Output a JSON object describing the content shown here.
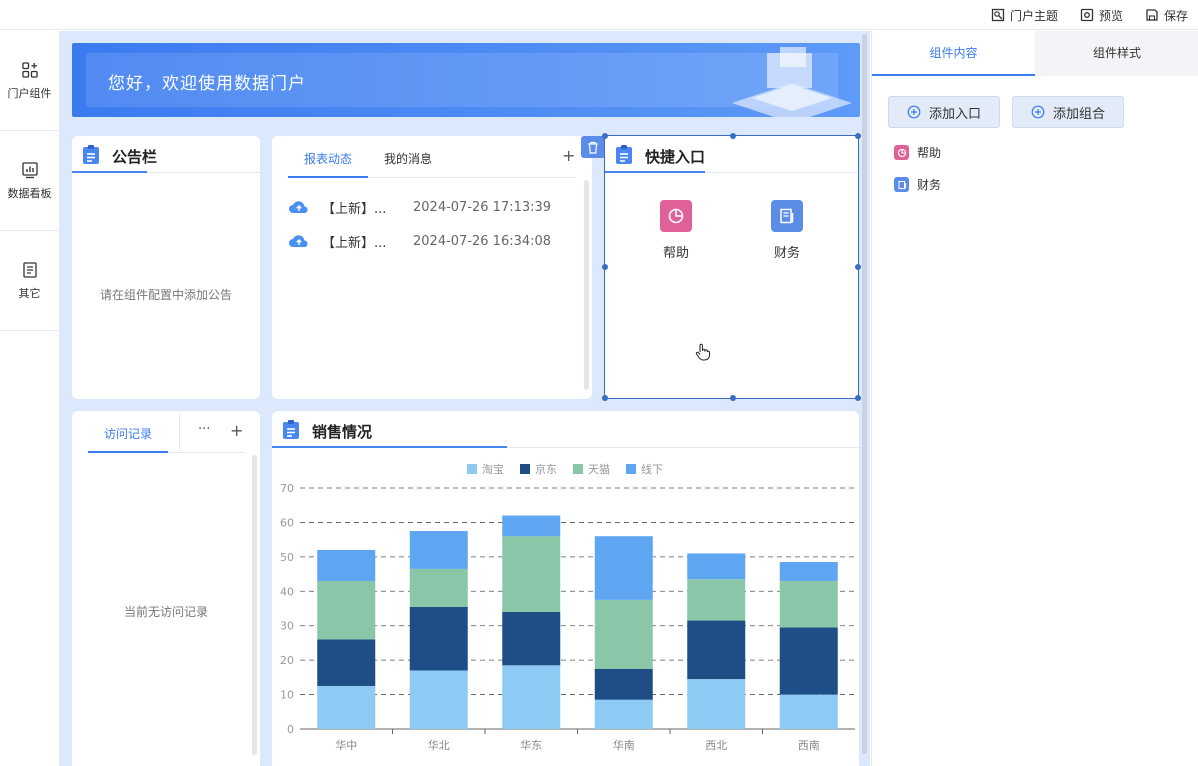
{
  "toolbar": {
    "theme_label": "门户主题",
    "preview_label": "预览",
    "save_label": "保存"
  },
  "sidebar": {
    "items": [
      {
        "label": "门户组件",
        "icon": "widgets-icon"
      },
      {
        "label": "数据看板",
        "icon": "chart-board-icon"
      },
      {
        "label": "其它",
        "icon": "document-icon"
      }
    ]
  },
  "banner": {
    "title": "您好，欢迎使用数据门户"
  },
  "notice": {
    "title": "公告栏",
    "empty_text": "请在组件配置中添加公告"
  },
  "messages": {
    "tabs": [
      "报表动态",
      "我的消息"
    ],
    "add_label": "+",
    "items": [
      {
        "title": "【上新】...",
        "time": "2024-07-26 17:13:39"
      },
      {
        "title": "【上新】...",
        "time": "2024-07-26 16:34:08"
      }
    ]
  },
  "quick_entry": {
    "title": "快捷入口",
    "items": [
      {
        "label": "帮助",
        "icon": "pie-chart-icon",
        "color": "#e0619a"
      },
      {
        "label": "财务",
        "icon": "report-icon",
        "color": "#5b8de8"
      }
    ]
  },
  "visits": {
    "tab": "访问记录",
    "more_label": "···",
    "add_label": "+",
    "empty_text": "当前无访问记录"
  },
  "sales": {
    "title": "销售情况"
  },
  "chart_data": {
    "type": "bar",
    "stacked": true,
    "title": "",
    "xlabel": "",
    "ylabel": "",
    "categories": [
      "华中",
      "华北",
      "华东",
      "华南",
      "西北",
      "西南"
    ],
    "series": [
      {
        "name": "淘宝",
        "color": "#8ecbf4",
        "values": [
          12.5,
          17,
          18.5,
          8.5,
          14.5,
          10
        ]
      },
      {
        "name": "京东",
        "color": "#1f4e86",
        "values": [
          13.5,
          18.5,
          15.5,
          9,
          17,
          19.5
        ]
      },
      {
        "name": "天猫",
        "color": "#8ac7a8",
        "values": [
          17,
          11,
          22,
          20,
          12,
          13.5
        ]
      },
      {
        "name": "线下",
        "color": "#5fa6f2",
        "values": [
          9,
          11,
          6,
          18.5,
          7.5,
          5.5
        ]
      }
    ],
    "ylim": [
      0,
      70
    ],
    "yticks": [
      0,
      10,
      20,
      30,
      40,
      50,
      60,
      70
    ],
    "grid": true,
    "legend": "top-center"
  },
  "right_panel": {
    "tabs": [
      "组件内容",
      "组件样式"
    ],
    "add_entry_label": "添加入口",
    "add_group_label": "添加组合",
    "items": [
      {
        "label": "帮助",
        "icon": "pie-chart-icon",
        "color": "#e0619a"
      },
      {
        "label": "财务",
        "icon": "report-icon",
        "color": "#5b8de8"
      }
    ]
  }
}
